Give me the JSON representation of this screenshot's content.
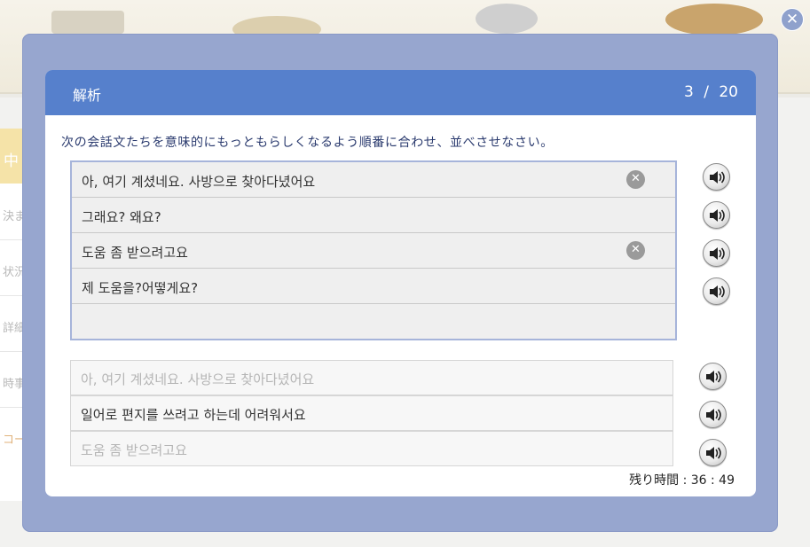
{
  "background": {
    "side_tab": "中",
    "side_items": [
      "決ま",
      "状況",
      "詳細",
      "時事",
      "コー"
    ]
  },
  "close_top": {
    "icon": "close-icon",
    "glyph": "✕"
  },
  "modal": {
    "title": "解析",
    "progress": {
      "current": "3",
      "separator": "/",
      "total": "20"
    },
    "instruction": "次の会話文たちを意味的にもっともらしくなるよう順番に合わせ、並べさせなさい。",
    "answers": [
      {
        "text": "아, 여기 계셨네요. 사방으로 찾아다녔어요",
        "removable": true
      },
      {
        "text": "그래요? 왜요?",
        "removable": false
      },
      {
        "text": "도움 좀 받으려고요",
        "removable": true
      },
      {
        "text": "제 도움을?어떻게요?",
        "removable": false
      },
      {
        "text": "",
        "removable": false
      }
    ],
    "options": [
      {
        "text": "아, 여기 계셨네요. 사방으로 찾아다녔어요",
        "state": "used"
      },
      {
        "text": "일어로 편지를 쓰려고 하는데 어려워서요",
        "state": "active"
      },
      {
        "text": "도움 좀 받으려고요",
        "state": "used"
      }
    ],
    "remove_glyph": "✕",
    "speaker_icon": "speaker-icon",
    "timer": {
      "label": "残り時間",
      "value": "36 : 49"
    }
  },
  "colors": {
    "header": "#5680cc",
    "modal_frame": "#97a6cf",
    "answer_border": "#a6b4da"
  }
}
